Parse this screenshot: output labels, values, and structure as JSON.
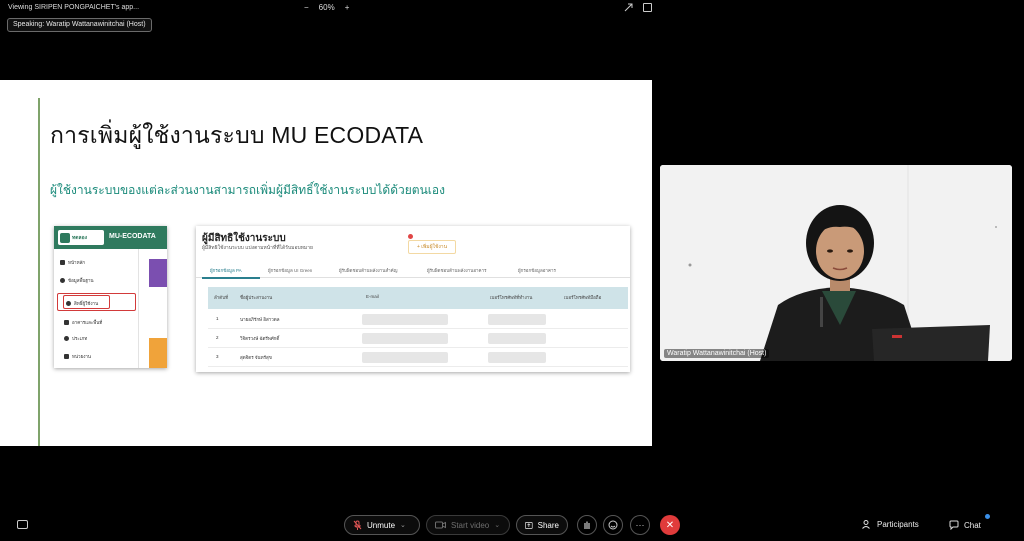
{
  "window": {
    "title": "Viewing SIRIPEN PONGPAICHET's app...",
    "zoom": "60%",
    "zoom_minus": "−",
    "zoom_plus": "+",
    "speaking_label": "Speaking: Waratip Wattanawinitchai (Host)"
  },
  "slide": {
    "heading": "การเพิ่มผู้ใช้งานระบบ MU ECODATA",
    "subheading": "ผู้ใช้งานระบบของแต่ละส่วนงานสามารถเพิ่มผู้มีสิทธิ์ใช้งานระบบได้ด้วยตนเอง",
    "mini_app": {
      "logo_text": "ทดลอง",
      "brand": "MU-ECODATA",
      "menu": [
        "หน้าหลัก",
        "ข้อมูลพื้นฐาน",
        "สิทธิ์ผู้ใช้งาน",
        "อาคารและพื้นที่",
        "ประเภท",
        "หน่วยงาน"
      ]
    },
    "table": {
      "title": "ผู้มีสิทธิใช้งานระบบ",
      "subtitle": "ผู้มีสิทธิใช้งานระบบ แบ่งตามหน้าที่ที่ได้รับมอบหมาย",
      "add_button": "+ เพิ่มผู้ใช้งาน",
      "tabs": [
        "ผู้กรอกข้อมูล PA",
        "ผู้กรอกข้อมูล UI Green",
        "ผู้รับผิดชอบด้านพลังงานสำคัญ",
        "ผู้รับผิดชอบด้านพลังงานอาคาร",
        "ผู้กรอกข้อมูลอาคาร"
      ],
      "columns": [
        "ลำดับที่",
        "ชื่อผู้ประสานงาน",
        "E-mail",
        "เบอร์โทรศัพท์ที่ทำงาน",
        "เบอร์โทรศัพท์มือถือ"
      ],
      "rows": [
        {
          "no": "1",
          "name": "นายอภิรักษ์ อิสาวดล"
        },
        {
          "no": "2",
          "name": "วิจิตรวงษ์ ฉัตรีพศักดิ์"
        },
        {
          "no": "3",
          "name": "สุดจิตร จันทร์สุข"
        }
      ]
    }
  },
  "video": {
    "participant_name": "Waratip Wattanawinitchai (Host)"
  },
  "toolbar": {
    "unmute": "Unmute",
    "start_video": "Start video",
    "share": "Share",
    "more": "···",
    "end": "✕",
    "participants": "Participants",
    "chat": "Chat"
  },
  "colors": {
    "end_button": "#e03b3b",
    "slide_accent": "#1a8a7a",
    "mini_header": "#2f7a5e",
    "highlight_box": "#d23a3a"
  }
}
